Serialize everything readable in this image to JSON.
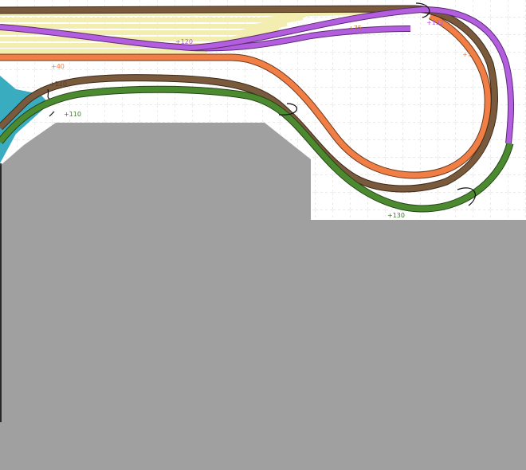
{
  "colors": {
    "background": "#ffffff",
    "grid": "#c8c8c8",
    "floor": "#a0a0a0",
    "water": "#3aacbf",
    "yellow_track": "#f3eeb0",
    "brown_track": "#7a5a3c",
    "orange_track": "#f07e45",
    "purple_track": "#b35ddf",
    "green_track": "#4c8a30"
  },
  "height_labels": {
    "yellow_top": "+75",
    "purple_top": "+132",
    "purple_mid": "+120",
    "orange_left": "+40",
    "orange_right": "+73",
    "brown_left": "+110",
    "green_left": "+110",
    "green_bottom": "+130"
  }
}
